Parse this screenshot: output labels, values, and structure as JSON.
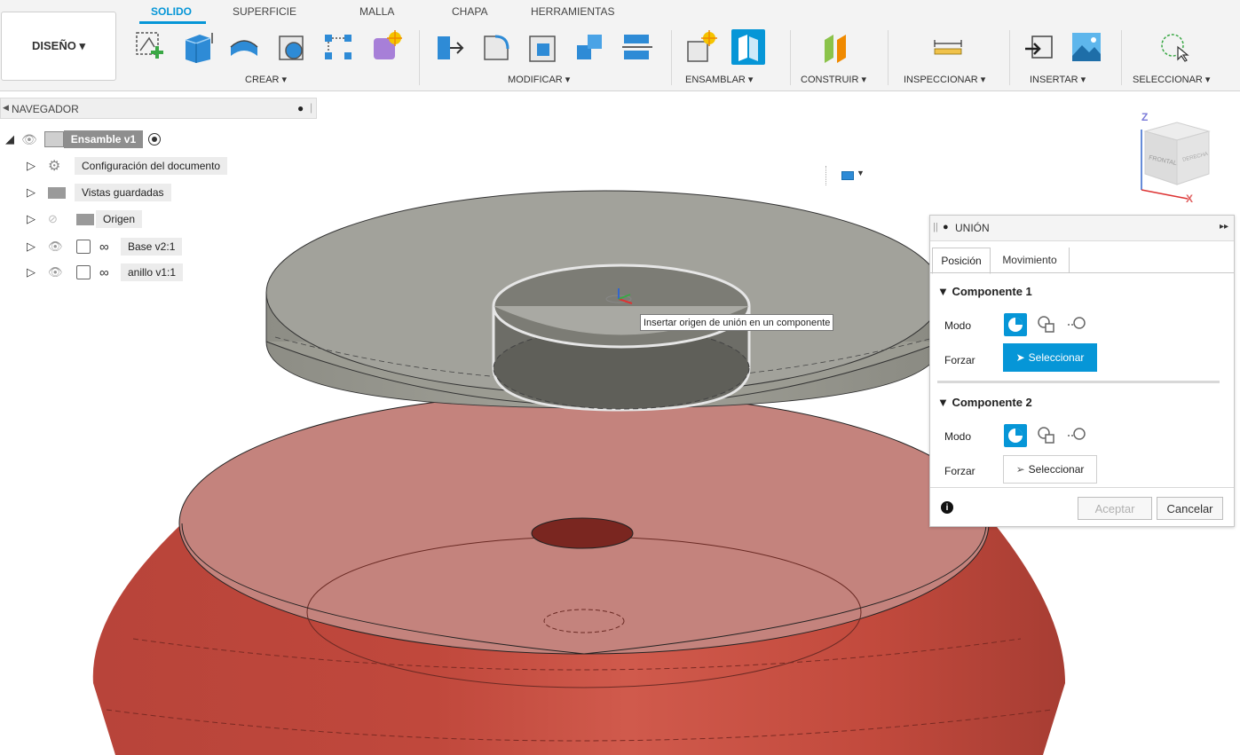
{
  "toolbar": {
    "design_label": "DISEÑO ▾",
    "tabs": [
      {
        "label": "SOLIDO",
        "active": true
      },
      {
        "label": "SUPERFICIE",
        "active": false
      },
      {
        "label": "MALLA",
        "active": false
      },
      {
        "label": "CHAPA",
        "active": false
      },
      {
        "label": "HERRAMIENTAS",
        "active": false
      }
    ],
    "groups": [
      {
        "label": "CREAR ▾"
      },
      {
        "label": "MODIFICAR ▾"
      },
      {
        "label": "ENSAMBLAR ▾"
      },
      {
        "label": "CONSTRUIR ▾"
      },
      {
        "label": "INSPECCIONAR ▾"
      },
      {
        "label": "INSERTAR ▾"
      },
      {
        "label": "SELECCIONAR ▾"
      }
    ],
    "accent_color": "#0696d7"
  },
  "navigator": {
    "title": "NAVEGADOR",
    "root": "Ensamble v1",
    "items": [
      {
        "label": "Configuración del documento",
        "icon": "gear-icon"
      },
      {
        "label": "Vistas guardadas",
        "icon": "folder-icon"
      },
      {
        "label": "Origen",
        "icon": "folder-icon"
      },
      {
        "label": "Base v2:1",
        "icon": "component-link-icon"
      },
      {
        "label": "anillo v1:1",
        "icon": "component-link-icon"
      }
    ]
  },
  "viewcube": {
    "top": "Z",
    "x_axis": "X",
    "front": "FRONTAL",
    "right": "DERECHA"
  },
  "tooltip": "Insertar origen de unión en un componente",
  "union_panel": {
    "title": "UNIÓN",
    "tabs": [
      "Posición",
      "Movimiento"
    ],
    "component1": {
      "title": "▼ Componente 1",
      "mode_label": "Modo",
      "snap_label": "Forzar",
      "select_label": "Seleccionar",
      "selected": true
    },
    "component2": {
      "title": "▼ Componente 2",
      "mode_label": "Modo",
      "snap_label": "Forzar",
      "select_label": "Seleccionar",
      "selected": false
    },
    "ok_label": "Aceptar",
    "cancel_label": "Cancelar"
  }
}
